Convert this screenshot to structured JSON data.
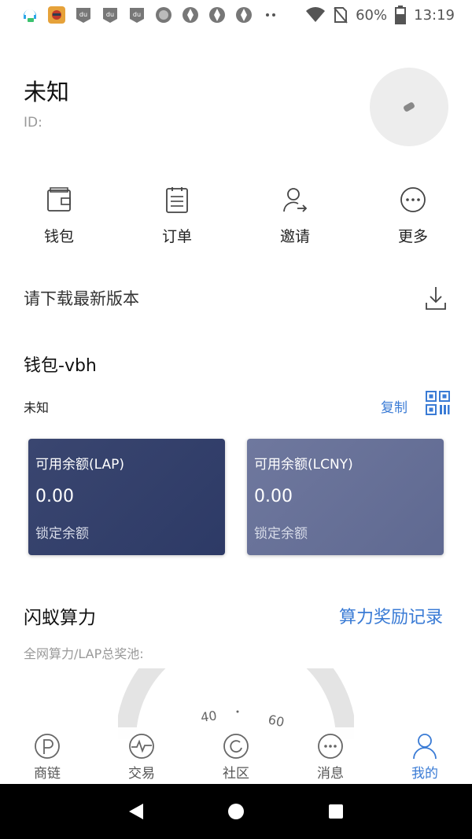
{
  "status_bar": {
    "battery": "60%",
    "time": "13:19",
    "icons": [
      "headset-icon",
      "game-avatar-icon",
      "du-icon",
      "du-icon",
      "du-icon",
      "record-icon",
      "aperture-icon",
      "aperture-icon",
      "aperture-icon",
      "dots-icon",
      "wifi-icon",
      "no-sim-icon",
      "battery-icon"
    ]
  },
  "profile": {
    "name": "未知",
    "id_label": "ID:"
  },
  "quick_menu": [
    {
      "label": "钱包",
      "icon": "wallet-icon"
    },
    {
      "label": "订单",
      "icon": "order-icon"
    },
    {
      "label": "邀请",
      "icon": "invite-icon"
    },
    {
      "label": "更多",
      "icon": "more-icon"
    }
  ],
  "download": {
    "text": "请下载最新版本",
    "icon": "download-icon"
  },
  "wallet": {
    "title": "钱包-vbh",
    "address": "未知",
    "copy_label": "复制",
    "qr_icon": "qr-code-icon",
    "cards": [
      {
        "label": "可用余额(LAP)",
        "value": "0.00",
        "lock_label": "锁定余额"
      },
      {
        "label": "可用余额(LCNY)",
        "value": "0.00",
        "lock_label": "锁定余额"
      }
    ]
  },
  "compute": {
    "title": "闪蚁算力",
    "link": "算力奖励记录",
    "subtitle": "全网算力/LAP总奖池:",
    "gauge_ticks": [
      "40",
      "60"
    ]
  },
  "tabs": [
    {
      "label": "商链",
      "icon": "chain-icon",
      "active": false
    },
    {
      "label": "交易",
      "icon": "trade-icon",
      "active": false
    },
    {
      "label": "社区",
      "icon": "community-icon",
      "active": false
    },
    {
      "label": "消息",
      "icon": "message-icon",
      "active": false
    },
    {
      "label": "我的",
      "icon": "profile-icon",
      "active": true
    }
  ],
  "colors": {
    "accent": "#3a7bd5",
    "card_lap": "#34416b",
    "card_lcny": "#6a7499"
  }
}
